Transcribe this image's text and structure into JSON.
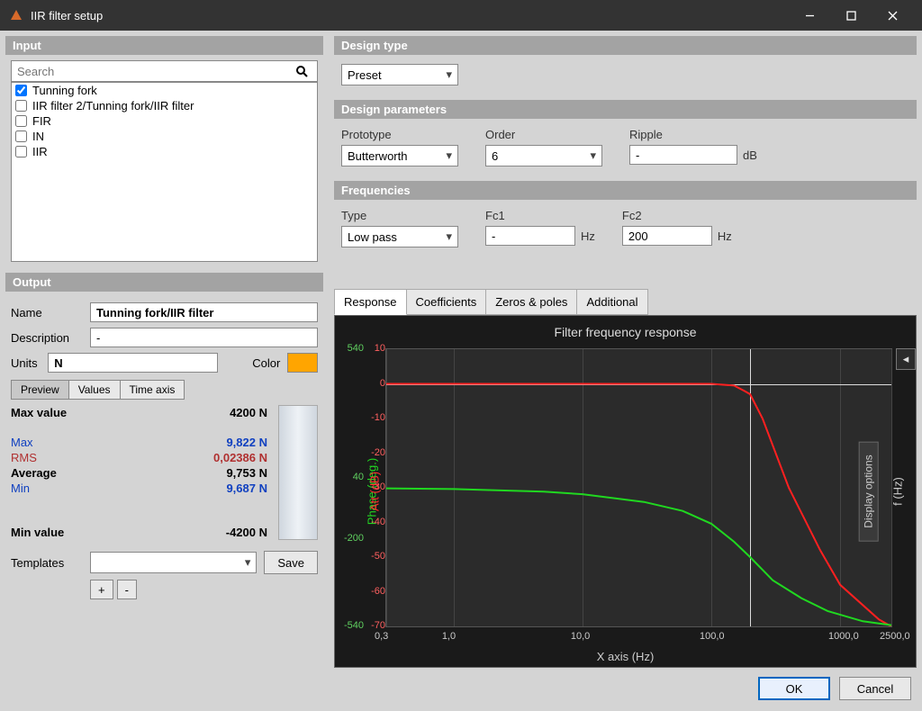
{
  "window": {
    "title": "IIR filter setup"
  },
  "input": {
    "header": "Input",
    "search_placeholder": "Search",
    "items": [
      {
        "label": "Tunning fork",
        "checked": true
      },
      {
        "label": "IIR filter 2/Tunning fork/IIR filter",
        "checked": false
      },
      {
        "label": "FIR",
        "checked": false
      },
      {
        "label": "IN",
        "checked": false
      },
      {
        "label": "IIR",
        "checked": false
      }
    ]
  },
  "output": {
    "header": "Output",
    "name_label": "Name",
    "name_value": "Tunning fork/IIR filter",
    "desc_label": "Description",
    "desc_value": "-",
    "units_label": "Units",
    "units_value": "N",
    "color_label": "Color",
    "color_hex": "#ffa500",
    "tabs": {
      "preview": "Preview",
      "values": "Values",
      "time": "Time axis"
    },
    "stats": {
      "maxvalue_label": "Max value",
      "maxvalue": "4200 N",
      "max_label": "Max",
      "max": "9,822 N",
      "rms_label": "RMS",
      "rms": "0,02386 N",
      "avg_label": "Average",
      "avg": "9,753 N",
      "min_label": "Min",
      "min": "9,687 N",
      "minvalue_label": "Min value",
      "minvalue": "-4200 N"
    },
    "templates_label": "Templates",
    "save_label": "Save",
    "plus": "+",
    "minus": "-"
  },
  "design": {
    "type_header": "Design type",
    "type_value": "Preset",
    "params_header": "Design parameters",
    "prototype_label": "Prototype",
    "prototype_value": "Butterworth",
    "order_label": "Order",
    "order_value": "6",
    "ripple_label": "Ripple",
    "ripple_value": "-",
    "ripple_unit": "dB",
    "freq_header": "Frequencies",
    "filter_type_label": "Type",
    "filter_type_value": "Low pass",
    "fc1_label": "Fc1",
    "fc1_value": "-",
    "fc1_unit": "Hz",
    "fc2_label": "Fc2",
    "fc2_value": "200",
    "fc2_unit": "Hz"
  },
  "plot": {
    "tabs": {
      "response": "Response",
      "coeff": "Coefficients",
      "zp": "Zeros & poles",
      "add": "Additional"
    },
    "title": "Filter frequency response",
    "phase_label": "Phase (deg.)",
    "att_label": "Att (dB)",
    "xlabel": "X axis (Hz)",
    "flabel": "f (Hz)",
    "disp": "Display options",
    "xticks": [
      "0,3",
      "1,0",
      "10,0",
      "100,0",
      "1000,0",
      "2500,0"
    ],
    "att_ticks": [
      "10",
      "0",
      "-10",
      "-20",
      "-30",
      "-40",
      "-50",
      "-60",
      "-70"
    ],
    "phase_ticks": [
      "540",
      "40",
      "-200",
      "-540"
    ]
  },
  "footer": {
    "ok": "OK",
    "cancel": "Cancel"
  },
  "chart_data": {
    "type": "line",
    "title": "Filter frequency response",
    "xlabel": "X axis (Hz)",
    "x_scale": "log",
    "xlim": [
      0.3,
      2500
    ],
    "series": [
      {
        "name": "Att (dB)",
        "color": "#ff2020",
        "yaxis": "att",
        "ylim": [
          -70,
          10
        ],
        "x": [
          0.3,
          1,
          10,
          50,
          100,
          150,
          180,
          200,
          250,
          400,
          700,
          1000,
          2000,
          2500
        ],
        "values": [
          0,
          0,
          0,
          0,
          0,
          -0.5,
          -2,
          -3,
          -10,
          -30,
          -48,
          -58,
          -68,
          -70
        ]
      },
      {
        "name": "Phase (deg.)",
        "color": "#20d820",
        "yaxis": "phase",
        "ylim": [
          -540,
          540
        ],
        "x": [
          0.3,
          1,
          5,
          10,
          30,
          60,
          100,
          150,
          200,
          300,
          500,
          800,
          1500,
          2500
        ],
        "values": [
          -2,
          -5,
          -15,
          -25,
          -55,
          -90,
          -140,
          -210,
          -270,
          -360,
          -430,
          -480,
          -520,
          -535
        ]
      }
    ]
  }
}
